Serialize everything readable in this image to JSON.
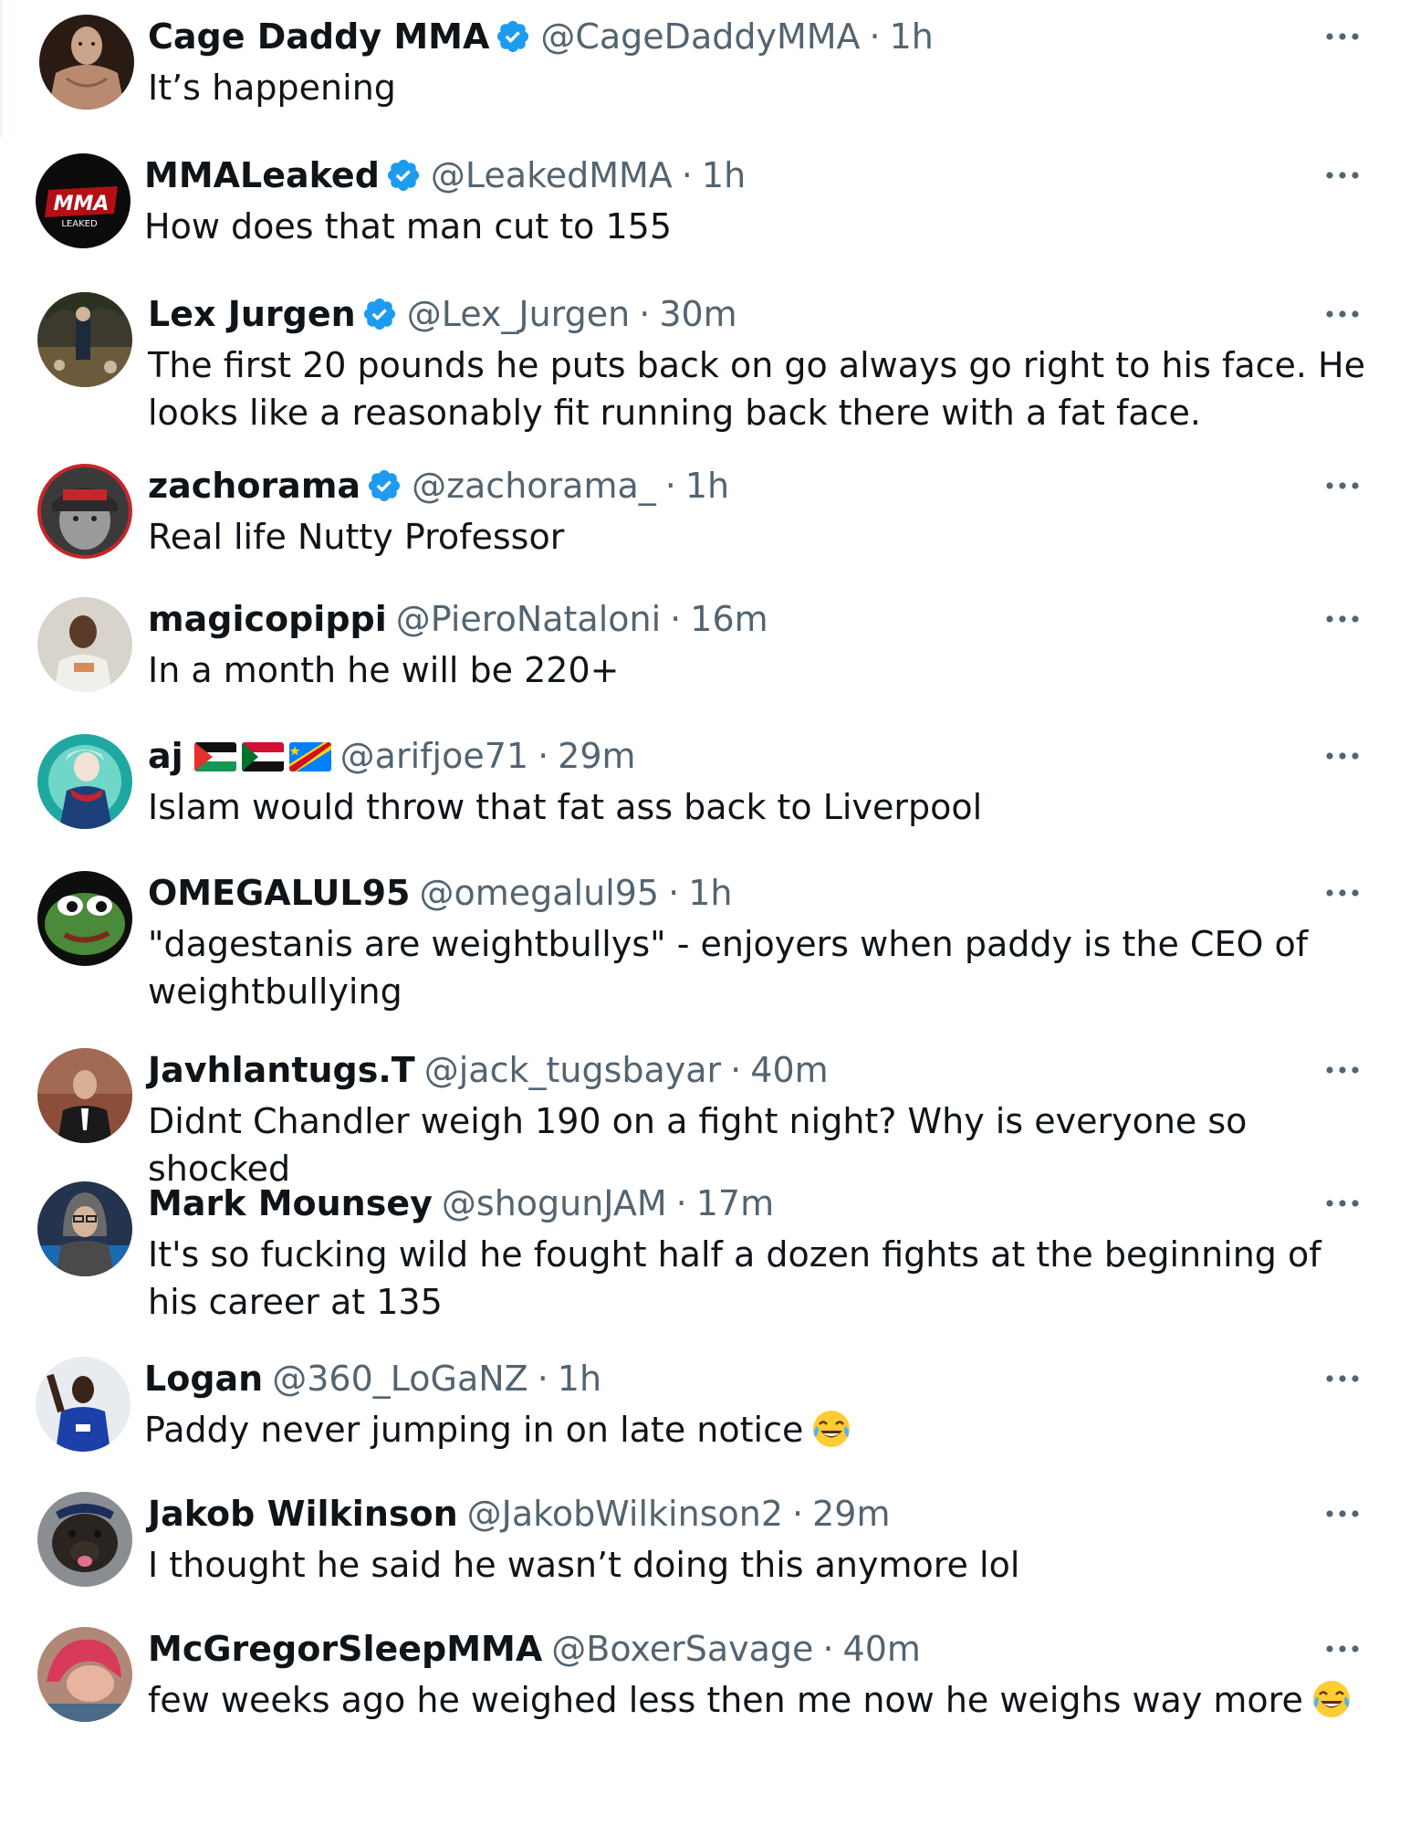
{
  "replies": [
    {
      "name": "Cage Daddy MMA",
      "verified": true,
      "handle": "@CageDaddyMMA",
      "sep": "·",
      "time": "1h",
      "text": "It’s happening",
      "avatar": "muscular-man-avatar"
    },
    {
      "name": "MMALeaked",
      "verified": true,
      "handle": "@LeakedMMA",
      "sep": "·",
      "time": "1h",
      "text": "How does that man cut to 155",
      "avatar": "mma-leaked-logo-avatar"
    },
    {
      "name": "Lex Jurgen",
      "verified": true,
      "handle": "@Lex_Jurgen",
      "sep": "·",
      "time": "30m",
      "text": "The first 20 pounds he puts back on go always go right to his face. He looks like a reasonably fit running back there with a fat face.",
      "avatar": "outdoor-photo-avatar"
    },
    {
      "name": "zachorama",
      "verified": true,
      "handle": "@zachorama_",
      "sep": "·",
      "time": "1h",
      "text": "Real life Nutty Professor",
      "avatar": "cap-man-avatar"
    },
    {
      "name": "magicopippi",
      "verified": false,
      "handle": "@PieroNataloni",
      "sep": "·",
      "time": "16m",
      "text": "In a month he will be 220+",
      "avatar": "young-man-avatar"
    },
    {
      "name": "aj",
      "verified": false,
      "flags": [
        "palestine-flag",
        "sudan-flag",
        "congo-flag"
      ],
      "handle": "@arifjoe71",
      "sep": "·",
      "time": "29m",
      "text": "Islam would throw that fat ass back to Liverpool",
      "avatar": "anime-character-avatar"
    },
    {
      "name": "OMEGALUL95",
      "verified": false,
      "handle": "@omegalul95",
      "sep": "·",
      "time": "1h",
      "text": "\"dagestanis are weightbullys\" - enjoyers when paddy is the CEO of weightbullying",
      "avatar": "pepe-frog-avatar"
    },
    {
      "name": "Javhlantugs.T",
      "verified": false,
      "handle": "@jack_tugsbayar",
      "sep": "·",
      "time": "40m",
      "text": "Didnt Chandler weigh 190 on a fight night? Why is everyone so shocked",
      "avatar": "suited-man-avatar"
    },
    {
      "name": "Mark Mounsey",
      "verified": false,
      "handle": "@shogunJAM",
      "sep": "·",
      "time": "17m",
      "text": "It's so fucking wild he fought half a dozen fights at the beginning of his career at 135",
      "avatar": "hooded-man-avatar"
    },
    {
      "name": "Logan",
      "verified": false,
      "handle": "@360_LoGaNZ",
      "sep": "·",
      "time": "1h",
      "text": "Paddy never jumping in on late notice",
      "emoji": "tears-of-joy-emoji",
      "avatar": "footballer-avatar"
    },
    {
      "name": "Jakob Wilkinson",
      "verified": false,
      "handle": "@JakobWilkinson2",
      "sep": "·",
      "time": "29m",
      "text": "I thought he said he wasn’t doing this anymore lol",
      "avatar": "dog-avatar"
    },
    {
      "name": "McGregorSleepMMA",
      "verified": false,
      "handle": "@BoxerSavage",
      "sep": "·",
      "time": "40m",
      "text": "few weeks ago he weighed less then me now he weighs way more",
      "emoji": "tears-of-joy-emoji",
      "avatar": "red-hair-person-avatar"
    }
  ],
  "colors": {
    "verified_blue": "#1d9bf0",
    "text_primary": "#0f1419",
    "text_secondary": "#536471"
  },
  "icons": {
    "verified": "verified-badge-icon",
    "more": "more-options-icon"
  }
}
